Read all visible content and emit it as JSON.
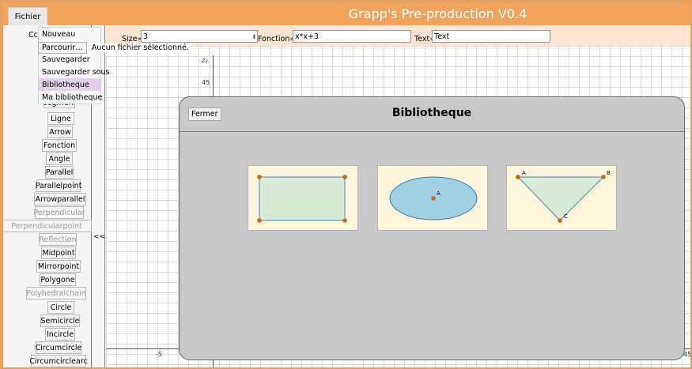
{
  "app": {
    "title": "Grapp's Pre-production V0.4"
  },
  "menu": {
    "fichier_label": "Fichier",
    "items": [
      "Nouveau",
      "Sauvegarder",
      "Sauvegarder sous",
      "Bibliotheque",
      "Ma bibliotheque"
    ],
    "selected_item": "Bibliotheque",
    "browse_label": "Parcourir…",
    "no_file_text": "Aucun fichier sélectionné."
  },
  "tools": {
    "partial_top": "Cc",
    "partial_segment": "Segment",
    "items": [
      {
        "label": "Ligne",
        "enabled": true
      },
      {
        "label": "Arrow",
        "enabled": true
      },
      {
        "label": "Fonction",
        "enabled": true
      },
      {
        "label": "Angle",
        "enabled": true
      },
      {
        "label": "Parallel",
        "enabled": true
      },
      {
        "label": "Parallelpoint",
        "enabled": true
      },
      {
        "label": "Arrowparallel",
        "enabled": true
      },
      {
        "label": "Perpendicular",
        "enabled": false
      },
      {
        "label": "Perpendicularpoint",
        "enabled": false
      },
      {
        "label": "Reflection",
        "enabled": false
      },
      {
        "label": "Midpoint",
        "enabled": true
      },
      {
        "label": "Mirrorpoint",
        "enabled": true
      },
      {
        "label": "Polygone",
        "enabled": true
      },
      {
        "label": "Polyhedralchain",
        "enabled": false
      },
      {
        "label": "Circle",
        "enabled": true
      },
      {
        "label": "Semicircle",
        "enabled": true
      },
      {
        "label": "Incircle",
        "enabled": true
      },
      {
        "label": "Circumcircle",
        "enabled": true
      },
      {
        "label": "Circumcirclearc",
        "enabled": true
      }
    ],
    "collapse_label": "<<"
  },
  "fields": {
    "size_label": "Size=",
    "size_value": "3",
    "fonction_label": "Fonction=",
    "fonction_value": "x*x+3",
    "text_label": "Text=",
    "text_value": "Text"
  },
  "canvas": {
    "y_axis_label": "z₂",
    "y_tick": "45",
    "x_tick_left": "-5",
    "x_tick_right": "45"
  },
  "library": {
    "title": "Bibliotheque",
    "close_label": "Fermer",
    "items": [
      {
        "kind": "rectangle"
      },
      {
        "kind": "ellipse",
        "point_label": "A"
      },
      {
        "kind": "triangle",
        "vertex_labels": [
          "A",
          "B",
          "C"
        ]
      }
    ]
  },
  "colors": {
    "title_bar": "#f0a45e",
    "field_bar": "#fbe4d0",
    "point": "#d0601a",
    "card_bg": "#fdf6dd"
  }
}
